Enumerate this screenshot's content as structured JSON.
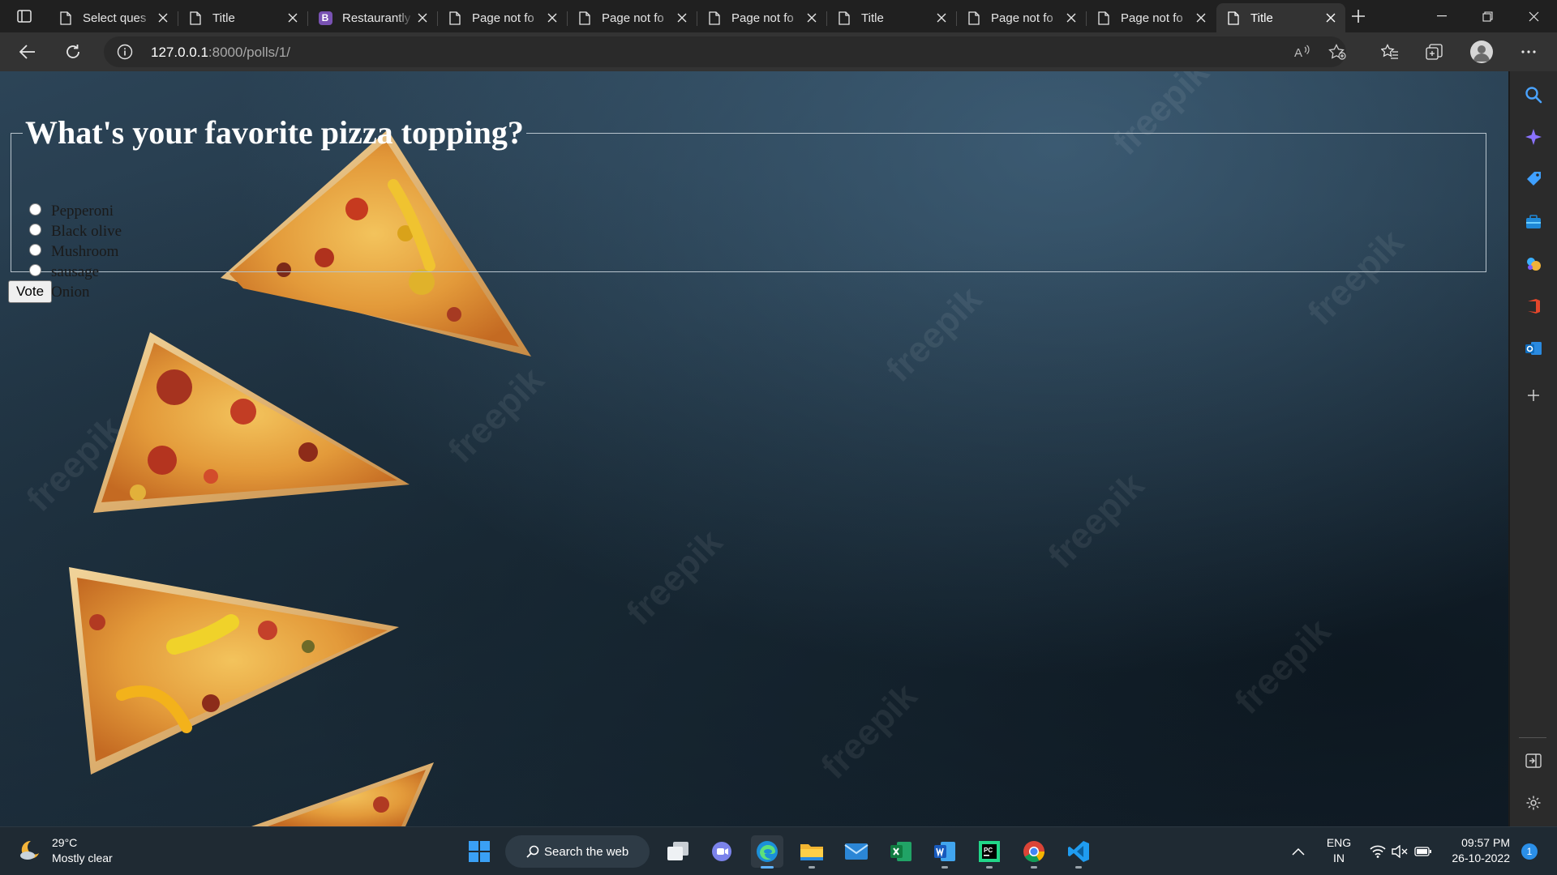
{
  "browser": {
    "tabs": [
      {
        "title": "Select ques",
        "icon": "page-icon",
        "active": false
      },
      {
        "title": "Title",
        "icon": "page-icon",
        "active": false
      },
      {
        "title": "Restaurantly",
        "icon": "bootstrap-icon",
        "icon_text": "B",
        "active": false
      },
      {
        "title": "Page not fo",
        "icon": "page-icon",
        "active": false
      },
      {
        "title": "Page not fo",
        "icon": "page-icon",
        "active": false
      },
      {
        "title": "Page not fo",
        "icon": "page-icon",
        "active": false
      },
      {
        "title": "Title",
        "icon": "page-icon",
        "active": false
      },
      {
        "title": "Page not fo",
        "icon": "page-icon",
        "active": false
      },
      {
        "title": "Page not fo",
        "icon": "page-icon",
        "active": false
      },
      {
        "title": "Title",
        "icon": "page-icon",
        "active": true
      }
    ],
    "url_host": "127.0.0.1",
    "url_rest": ":8000/polls/1/",
    "read_aloud_label": "A⁾"
  },
  "page": {
    "question": "What's your favorite pizza topping?",
    "choices": [
      "Pepperoni",
      "Black olive",
      "Mushroom",
      "sausage",
      "Onion"
    ],
    "vote_label": "Vote",
    "watermark_text": "freepik"
  },
  "taskbar": {
    "weather_temp": "29°C",
    "weather_desc": "Mostly clear",
    "search_label": "Search the web",
    "lang_1": "ENG",
    "lang_2": "IN",
    "time": "09:57 PM",
    "date": "26-10-2022",
    "notification_count": "1",
    "apps": [
      "start-icon",
      "task-view-icon",
      "teams-chat-icon",
      "edge-icon",
      "file-explorer-icon",
      "mail-icon",
      "excel-icon",
      "word-icon",
      "pycharm-icon",
      "chrome-icon",
      "vscode-icon"
    ]
  },
  "colors": {
    "page_bg": "#1f3344",
    "legend_text": "#ffffff",
    "tab_active_bg": "#333333",
    "titlebar_bg": "#202020",
    "taskbar_bg": "#1f2a33",
    "bootstrap_purple": "#7952b3"
  }
}
